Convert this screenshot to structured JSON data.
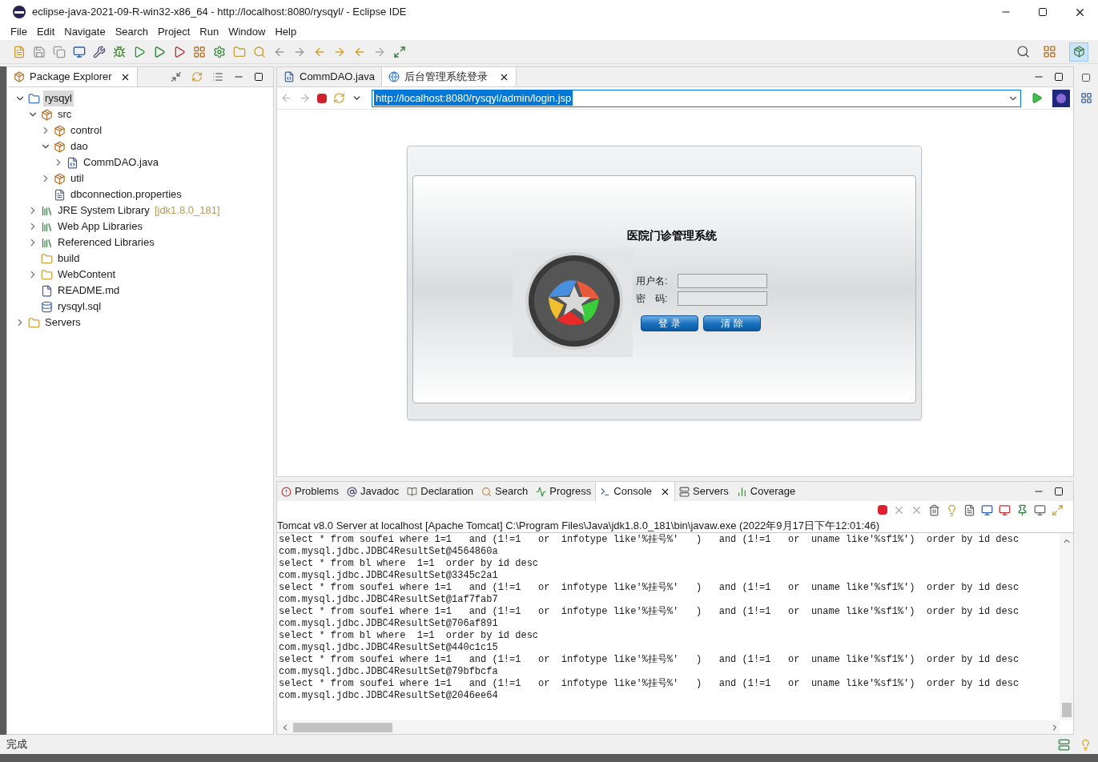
{
  "window": {
    "title": "eclipse-java-2021-09-R-win32-x86_64 - http://localhost:8080/rysqyl/ - Eclipse IDE"
  },
  "menu": [
    "File",
    "Edit",
    "Navigate",
    "Search",
    "Project",
    "Run",
    "Window",
    "Help"
  ],
  "package_explorer": {
    "title": "Package Explorer",
    "tree": [
      {
        "label": "rysqyl",
        "kind": "project",
        "expanded": true,
        "selected": true,
        "children": [
          {
            "label": "src",
            "kind": "source",
            "expanded": true,
            "selected": false,
            "children": [
              {
                "label": "control",
                "kind": "package",
                "expanded": false,
                "selected": false
              },
              {
                "label": "dao",
                "kind": "package",
                "expanded": true,
                "selected": false,
                "children": [
                  {
                    "label": "CommDAO.java",
                    "kind": "java",
                    "expanded": false,
                    "selected": false
                  }
                ]
              },
              {
                "label": "util",
                "kind": "package",
                "expanded": false,
                "selected": false
              },
              {
                "label": "dbconnection.properties",
                "kind": "text",
                "selected": false
              }
            ]
          },
          {
            "label": "JRE System Library",
            "decoration": "[jdk1.8.0_181]",
            "kind": "library",
            "expanded": false,
            "selected": false
          },
          {
            "label": "Web App Libraries",
            "kind": "library",
            "expanded": false,
            "selected": false
          },
          {
            "label": "Referenced Libraries",
            "kind": "library",
            "expanded": false,
            "selected": false
          },
          {
            "label": "build",
            "kind": "folder",
            "selected": false
          },
          {
            "label": "WebContent",
            "kind": "folder",
            "expanded": false,
            "selected": false
          },
          {
            "label": "README.md",
            "kind": "doc",
            "selected": false
          },
          {
            "label": "rysqyl.sql",
            "kind": "sql",
            "selected": false
          }
        ]
      },
      {
        "label": "Servers",
        "kind": "folder",
        "expanded": false,
        "selected": false
      }
    ]
  },
  "editor_tabs": [
    {
      "label": "CommDAO.java",
      "kind": "java",
      "selected": false
    },
    {
      "label": "后台管理系统登录",
      "kind": "web",
      "selected": true
    }
  ],
  "browser": {
    "url": "http://localhost:8080/rysqyl/admin/login.jsp"
  },
  "login_page": {
    "title": "医院门诊管理系统",
    "username_label": "用户名:",
    "password_label": "密　码:",
    "buttons": [
      "登 录",
      "清 除"
    ]
  },
  "bottom_tabs": [
    {
      "label": "Problems",
      "kind": "problems",
      "selected": false
    },
    {
      "label": "Javadoc",
      "kind": "javadoc",
      "selected": false
    },
    {
      "label": "Declaration",
      "kind": "declaration",
      "selected": false
    },
    {
      "label": "Search",
      "kind": "search",
      "selected": false
    },
    {
      "label": "Progress",
      "kind": "progress",
      "selected": false
    },
    {
      "label": "Console",
      "kind": "console",
      "selected": true
    },
    {
      "label": "Servers",
      "kind": "servers",
      "selected": false
    },
    {
      "label": "Coverage",
      "kind": "coverage",
      "selected": false
    }
  ],
  "console": {
    "header": "Tomcat v8.0 Server at localhost [Apache Tomcat] C:\\Program Files\\Java\\jdk1.8.0_181\\bin\\javaw.exe  (2022年9月17日下午12:01:46)",
    "lines": [
      "select * from soufei where 1=1   and (1!=1   or  infotype like'%挂号%'   )   and (1!=1   or  uname like'%sf1%')  order by id desc",
      "com.mysql.jdbc.JDBC4ResultSet@4564860a",
      "select * from bl where  1=1  order by id desc",
      "com.mysql.jdbc.JDBC4ResultSet@3345c2a1",
      "select * from soufei where 1=1   and (1!=1   or  infotype like'%挂号%'   )   and (1!=1   or  uname like'%sf1%')  order by id desc",
      "com.mysql.jdbc.JDBC4ResultSet@1af7fab7",
      "select * from soufei where 1=1   and (1!=1   or  infotype like'%挂号%'   )   and (1!=1   or  uname like'%sf1%')  order by id desc",
      "com.mysql.jdbc.JDBC4ResultSet@706af891",
      "select * from bl where  1=1  order by id desc",
      "com.mysql.jdbc.JDBC4ResultSet@440c1c15",
      "select * from soufei where 1=1   and (1!=1   or  infotype like'%挂号%'   )   and (1!=1   or  uname like'%sf1%')  order by id desc",
      "com.mysql.jdbc.JDBC4ResultSet@79bfbcfa",
      "select * from soufei where 1=1   and (1!=1   or  infotype like'%挂号%'   )   and (1!=1   or  uname like'%sf1%')  order by id desc",
      "com.mysql.jdbc.JDBC4ResultSet@2046ee64"
    ]
  },
  "status_bar": {
    "text": "完成"
  }
}
